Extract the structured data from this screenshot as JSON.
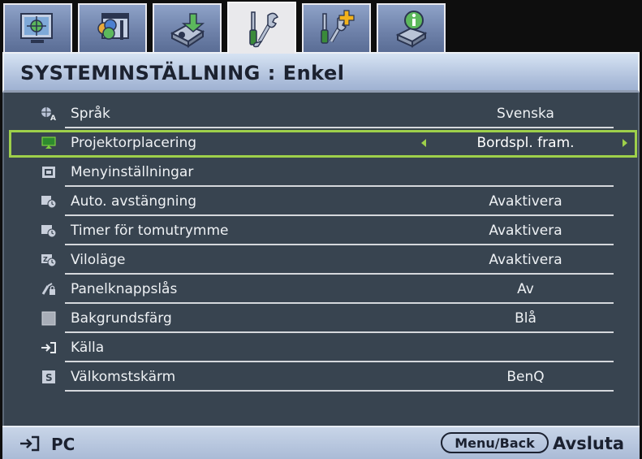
{
  "tabs": [
    {
      "name": "picture-tab",
      "icon": "display-icon",
      "active": false
    },
    {
      "name": "advanced-picture-tab",
      "icon": "color-picture-icon",
      "active": false
    },
    {
      "name": "source-tab",
      "icon": "projector-input-icon",
      "active": false
    },
    {
      "name": "system-basic-tab",
      "icon": "tools-icon",
      "active": true
    },
    {
      "name": "system-advanced-tab",
      "icon": "tools-plus-icon",
      "active": false
    },
    {
      "name": "information-tab",
      "icon": "info-projector-icon",
      "active": false
    }
  ],
  "header": {
    "title": "SYSTEMINSTÄLLNING : Enkel"
  },
  "menu": {
    "items": [
      {
        "label": "Språk",
        "value": "Svenska",
        "icon": "language-icon"
      },
      {
        "label": "Projektorplacering",
        "value": "Bordspl. fram.",
        "icon": "projector-position-icon",
        "selected": true
      },
      {
        "label": "Menyinställningar",
        "value": "",
        "icon": "menu-settings-icon"
      },
      {
        "label": "Auto. avstängning",
        "value": "Avaktivera",
        "icon": "auto-power-off-icon"
      },
      {
        "label": "Timer för tomutrymme",
        "value": "Avaktivera",
        "icon": "blank-timer-icon"
      },
      {
        "label": "Viloläge",
        "value": "Avaktivera",
        "icon": "sleep-icon"
      },
      {
        "label": "Panelknappslås",
        "value": "Av",
        "icon": "key-lock-icon"
      },
      {
        "label": "Bakgrundsfärg",
        "value": "Blå",
        "icon": "background-color-icon"
      },
      {
        "label": "Källa",
        "value": "",
        "icon": "source-icon"
      },
      {
        "label": "Välkomstskärm",
        "value": "BenQ",
        "icon": "splash-screen-icon"
      }
    ]
  },
  "footer": {
    "source_label": "PC",
    "key_label": "Menu/Back",
    "exit_label": "Avsluta"
  },
  "colors": {
    "accent": "#9ed04a",
    "panel": "#384450",
    "title_bar": "#aebfdb",
    "active_tab": "#e9e9ec",
    "inactive_tab": "#6d80a8"
  }
}
